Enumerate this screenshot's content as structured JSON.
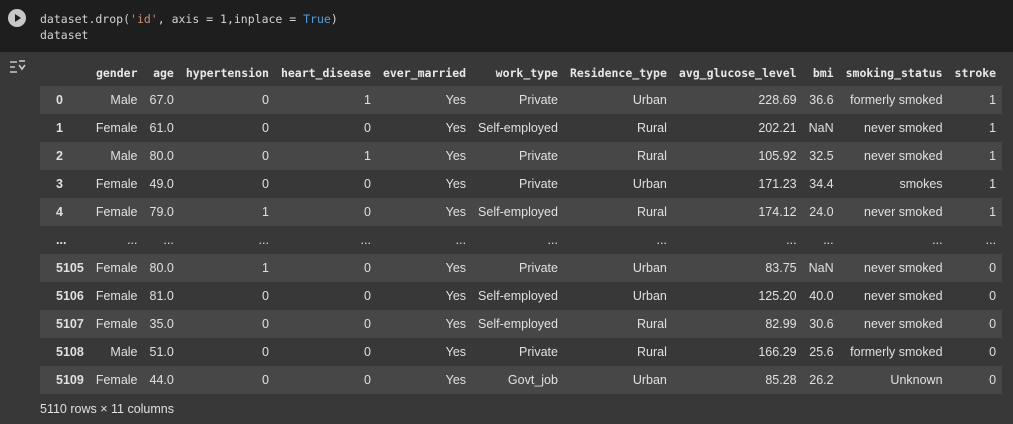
{
  "code": {
    "line1_a": "dataset.drop(",
    "line1_str": "'id'",
    "line1_b": ", axis = 1,inplace = ",
    "line1_kw": "True",
    "line1_c": ")",
    "line2": "dataset"
  },
  "table": {
    "columns": [
      "",
      "gender",
      "age",
      "hypertension",
      "heart_disease",
      "ever_married",
      "work_type",
      "Residence_type",
      "avg_glucose_level",
      "bmi",
      "smoking_status",
      "stroke"
    ],
    "rows": [
      [
        "0",
        "Male",
        "67.0",
        "0",
        "1",
        "Yes",
        "Private",
        "Urban",
        "228.69",
        "36.6",
        "formerly smoked",
        "1"
      ],
      [
        "1",
        "Female",
        "61.0",
        "0",
        "0",
        "Yes",
        "Self-employed",
        "Rural",
        "202.21",
        "NaN",
        "never smoked",
        "1"
      ],
      [
        "2",
        "Male",
        "80.0",
        "0",
        "1",
        "Yes",
        "Private",
        "Rural",
        "105.92",
        "32.5",
        "never smoked",
        "1"
      ],
      [
        "3",
        "Female",
        "49.0",
        "0",
        "0",
        "Yes",
        "Private",
        "Urban",
        "171.23",
        "34.4",
        "smokes",
        "1"
      ],
      [
        "4",
        "Female",
        "79.0",
        "1",
        "0",
        "Yes",
        "Self-employed",
        "Rural",
        "174.12",
        "24.0",
        "never smoked",
        "1"
      ],
      [
        "...",
        "...",
        "...",
        "...",
        "...",
        "...",
        "...",
        "...",
        "...",
        "...",
        "...",
        "..."
      ],
      [
        "5105",
        "Female",
        "80.0",
        "1",
        "0",
        "Yes",
        "Private",
        "Urban",
        "83.75",
        "NaN",
        "never smoked",
        "0"
      ],
      [
        "5106",
        "Female",
        "81.0",
        "0",
        "0",
        "Yes",
        "Self-employed",
        "Urban",
        "125.20",
        "40.0",
        "never smoked",
        "0"
      ],
      [
        "5107",
        "Female",
        "35.0",
        "0",
        "0",
        "Yes",
        "Self-employed",
        "Rural",
        "82.99",
        "30.6",
        "never smoked",
        "0"
      ],
      [
        "5108",
        "Male",
        "51.0",
        "0",
        "0",
        "Yes",
        "Private",
        "Rural",
        "166.29",
        "25.6",
        "formerly smoked",
        "0"
      ],
      [
        "5109",
        "Female",
        "44.0",
        "0",
        "0",
        "Yes",
        "Govt_job",
        "Urban",
        "85.28",
        "26.2",
        "Unknown",
        "0"
      ]
    ]
  },
  "footer": "5110 rows × 11 columns",
  "icons": {
    "run": "play-icon",
    "output": "output-toggle-icon"
  },
  "colors": {
    "code_bg": "#1e1e1e",
    "output_bg": "#383838",
    "stripe": "#474747",
    "string": "#ce9178",
    "keyword": "#569cd6"
  }
}
